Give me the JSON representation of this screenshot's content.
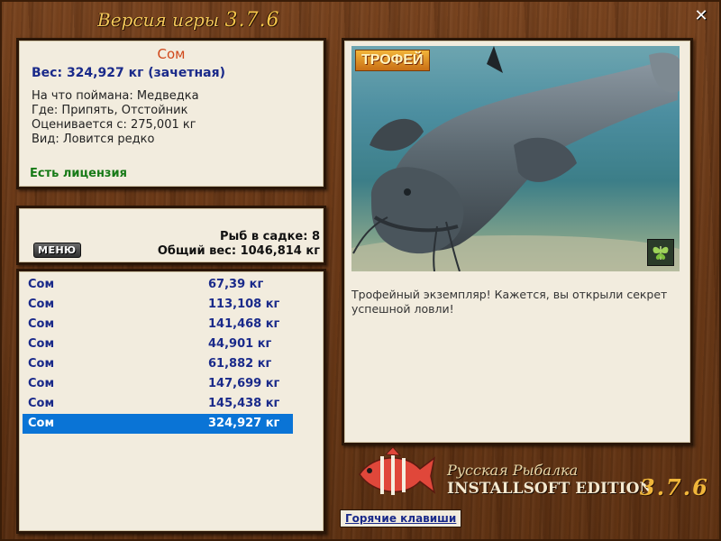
{
  "window": {
    "title": "Версия игры",
    "version": "3.7.6",
    "close_label": "✕"
  },
  "fish_info": {
    "name": "Сом",
    "weight": "Вес: 324,927 кг (зачетная)",
    "bait": "На что поймана: Медведка",
    "location": "Где: Припять, Отстойник",
    "valued_from": "Оценивается с: 275,001 кг",
    "rarity": "Вид: Ловится редко",
    "license": "Есть лицензия"
  },
  "keepnet": {
    "menu_label": "МЕНЮ",
    "count": "Рыб в садке: 8",
    "total_weight": "Общий вес: 1046,814 кг"
  },
  "catch_list": [
    {
      "name": "Сом",
      "weight": "67,39 кг"
    },
    {
      "name": "Сом",
      "weight": "113,108 кг"
    },
    {
      "name": "Сом",
      "weight": "141,468 кг"
    },
    {
      "name": "Сом",
      "weight": "44,901 кг"
    },
    {
      "name": "Сом",
      "weight": "61,882 кг"
    },
    {
      "name": "Сом",
      "weight": "147,699 кг"
    },
    {
      "name": "Сом",
      "weight": "145,438 кг"
    },
    {
      "name": "Сом",
      "weight": "324,927 кг",
      "selected": true
    }
  ],
  "photo": {
    "badge": "ТРОФЕЙ",
    "corner_icon": "butterfly-icon",
    "description": "Трофейный экземпляр! Кажется, вы открыли секрет успешной ловли!"
  },
  "logo": {
    "line1": "Русская Рыбалка",
    "line2": "INSTALLSOFT EDITION",
    "version": "3.7.6"
  },
  "hotkeys_label": "Горячие клавиши",
  "colors": {
    "fish_name": "#d0481a",
    "weight_text": "#1a2a8a",
    "license": "#177a17",
    "selected_row": "#0a74d6",
    "title_gold": "#f3c75a"
  }
}
